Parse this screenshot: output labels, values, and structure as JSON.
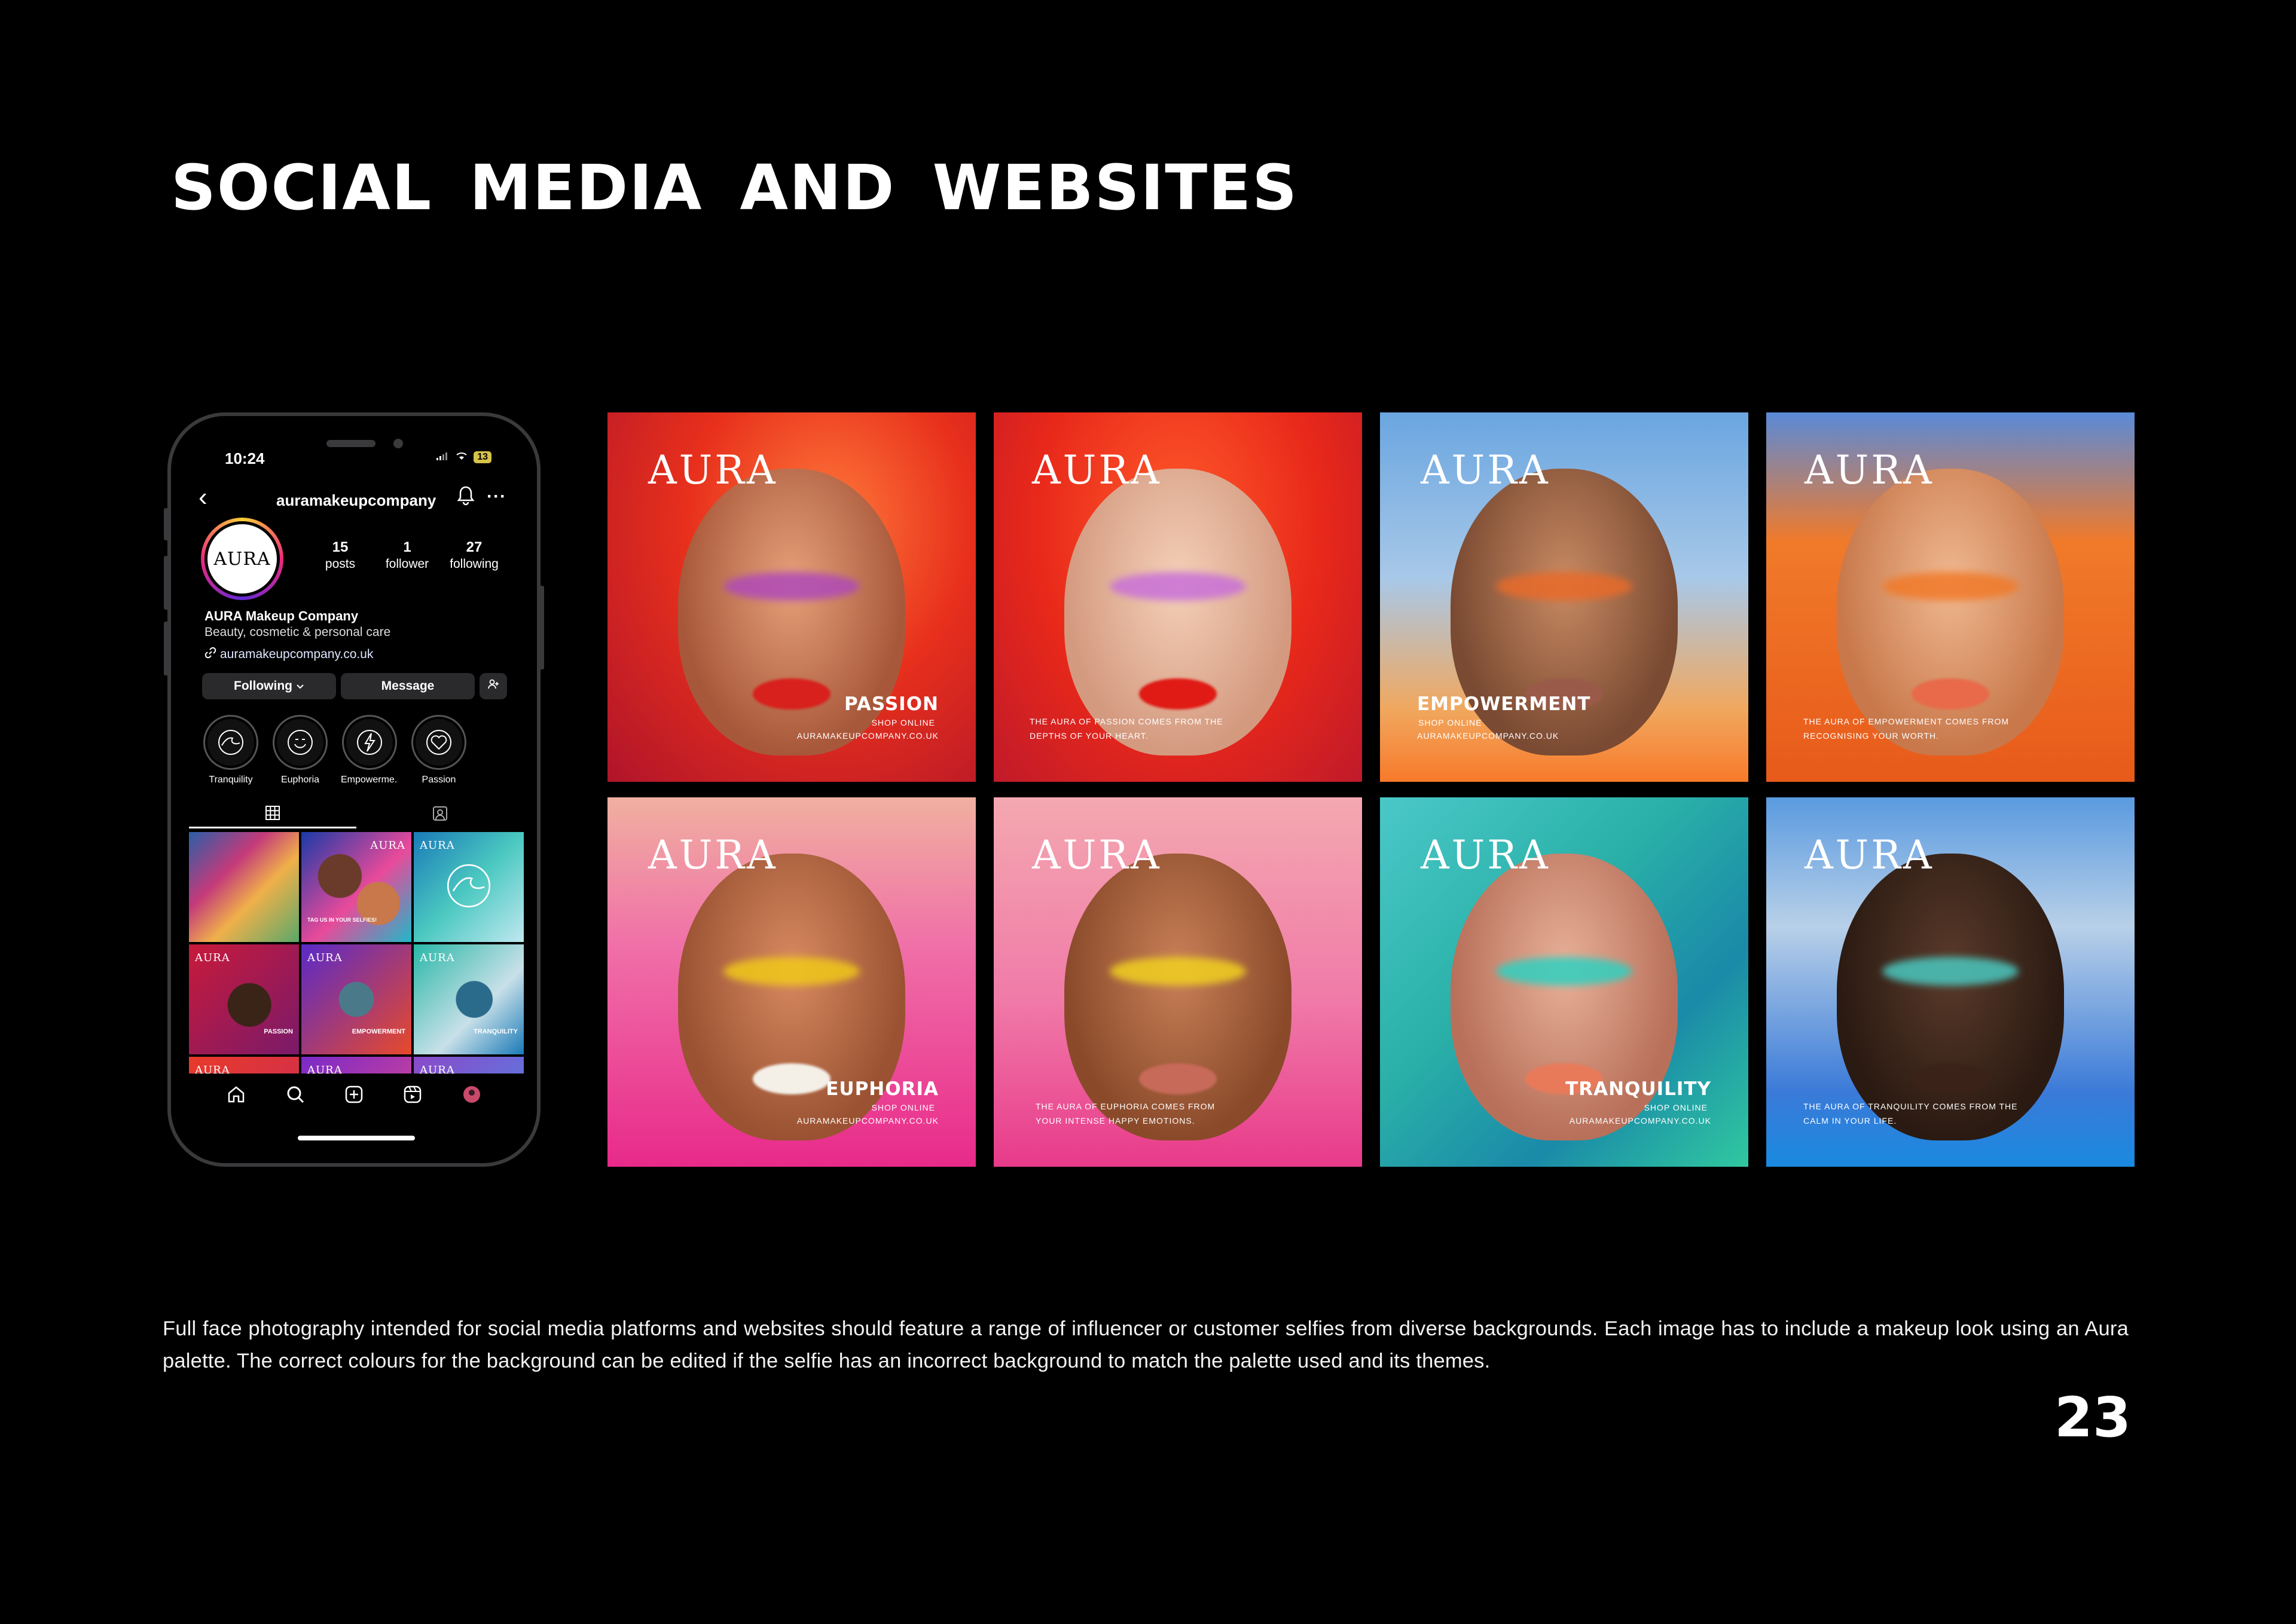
{
  "page": {
    "title": "SOCIAL MEDIA AND WEBSITES",
    "page_number": "23",
    "description": "Full face photography intended for social media platforms and websites should feature a range of influencer or customer selfies from diverse backgrounds. Each image has to include a makeup look using an Aura palette. The correct colours for the background can be edited if the selfie has an incorrect background to match the palette used and its themes."
  },
  "phone": {
    "status_time": "10:24",
    "battery": "13",
    "username": "auramakeupcompany",
    "avatar_text": "AURA",
    "stats": [
      {
        "num": "15",
        "label": "posts"
      },
      {
        "num": "1",
        "label": "follower"
      },
      {
        "num": "27",
        "label": "following"
      }
    ],
    "bio_name": "AURA Makeup Company",
    "bio_category": "Beauty, cosmetic & personal care",
    "bio_link": "auramakeupcompany.co.uk",
    "following_label": "Following",
    "message_label": "Message",
    "highlights": [
      "Tranquility",
      "Euphoria",
      "Empowerme...",
      "Passion"
    ],
    "grid": [
      {
        "aura": "",
        "theme": "",
        "tagline": ""
      },
      {
        "aura": "AURA",
        "theme": "",
        "tagline": "TAG US IN YOUR SELFIES!"
      },
      {
        "aura": "AURA",
        "theme": "",
        "tagline": ""
      },
      {
        "aura": "AURA",
        "theme": "PASSION",
        "tagline": ""
      },
      {
        "aura": "AURA",
        "theme": "EMPOWERMENT",
        "tagline": ""
      },
      {
        "aura": "AURA",
        "theme": "TRANQUILITY",
        "tagline": ""
      },
      {
        "aura": "AURA",
        "theme": "",
        "tagline": ""
      },
      {
        "aura": "AURA",
        "theme": "",
        "tagline": ""
      },
      {
        "aura": "AURA",
        "theme": "",
        "tagline": ""
      }
    ]
  },
  "posts": [
    {
      "logo": "AURA",
      "theme": "PASSION",
      "shop": "SHOP ONLINE",
      "url": "AURAMAKEUPCOMPANY.CO.UK",
      "tagline": ""
    },
    {
      "logo": "AURA",
      "theme": "",
      "shop": "",
      "url": "",
      "tagline": "THE AURA OF PASSION COMES FROM THE DEPTHS OF YOUR HEART."
    },
    {
      "logo": "AURA",
      "theme": "EMPOWERMENT",
      "shop": "SHOP ONLINE",
      "url": "AURAMAKEUPCOMPANY.CO.UK",
      "tagline": ""
    },
    {
      "logo": "AURA",
      "theme": "",
      "shop": "",
      "url": "",
      "tagline": "THE AURA OF EMPOWERMENT COMES FROM RECOGNISING YOUR WORTH."
    },
    {
      "logo": "AURA",
      "theme": "EUPHORIA",
      "shop": "SHOP ONLINE",
      "url": "AURAMAKEUPCOMPANY.CO.UK",
      "tagline": ""
    },
    {
      "logo": "AURA",
      "theme": "",
      "shop": "",
      "url": "",
      "tagline": "THE AURA OF EUPHORIA COMES FROM YOUR INTENSE HAPPY EMOTIONS."
    },
    {
      "logo": "AURA",
      "theme": "TRANQUILITY",
      "shop": "SHOP ONLINE",
      "url": "AURAMAKEUPCOMPANY.CO.UK",
      "tagline": ""
    },
    {
      "logo": "AURA",
      "theme": "",
      "shop": "",
      "url": "",
      "tagline": "THE AURA OF TRANQUILITY COMES FROM THE CALM IN YOUR LIFE."
    }
  ],
  "colors": {
    "passion": "#e8381c",
    "euphoria": "#ff6ea8",
    "empowerment": "#f06a20",
    "tranquility": "#2dbfa8",
    "sky": "#6aa6e0"
  }
}
